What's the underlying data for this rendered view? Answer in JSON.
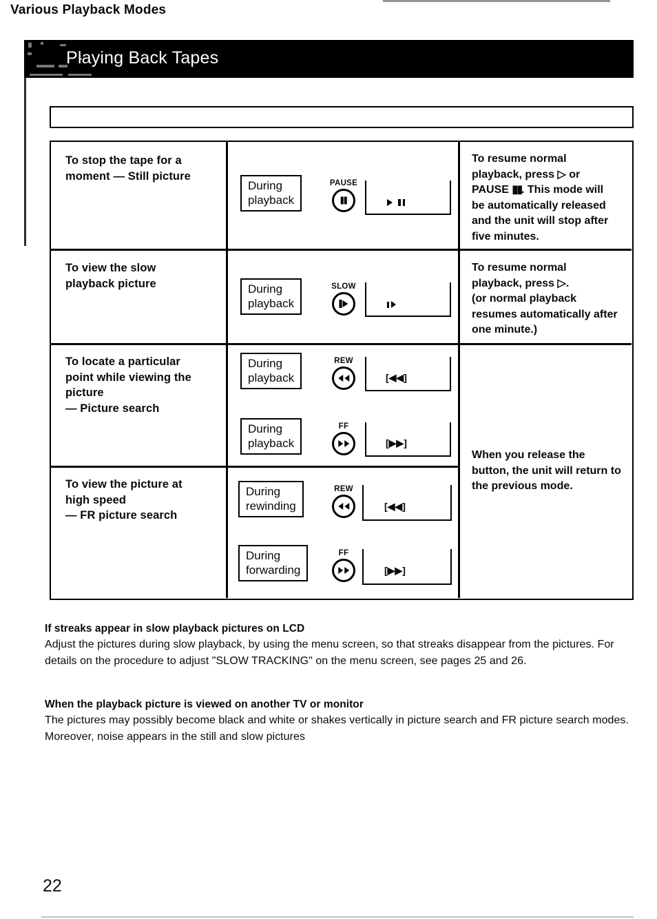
{
  "page": {
    "header_title": "Playing Back Tapes",
    "section_title": "Various Playback Modes",
    "page_number": "22"
  },
  "table": {
    "rows": [
      {
        "description": "To stop the tape for a\nmoment — Still picture",
        "operations": [
          {
            "state": "During\nplayback",
            "button_label": "PAUSE",
            "button_icon": "pause-icon",
            "lcd_indicator": "play-pause-indicator"
          }
        ],
        "note": "To resume normal playback, press ▷ or PAUSE ▮▮. This mode will be automatically released and the unit will stop after five minutes."
      },
      {
        "description": "To view the slow\nplayback picture",
        "operations": [
          {
            "state": "During\nplayback",
            "button_label": "SLOW",
            "button_icon": "slow-icon",
            "lcd_indicator": "slow-indicator"
          }
        ],
        "note": "To resume normal playback, press ▷.\n(or normal playback resumes automatically after one minute.)"
      },
      {
        "description": "To locate a particular\npoint while viewing the\npicture\n— Picture search",
        "operations": [
          {
            "state": "During\nplayback",
            "button_label": "REW",
            "button_icon": "rewind-icon",
            "lcd_indicator": "[◀◀]"
          },
          {
            "state": "During\nplayback",
            "button_label": "FF",
            "button_icon": "fast-forward-icon",
            "lcd_indicator": "[▶▶]"
          }
        ],
        "note": "When you release the button, the unit will return to the previous mode."
      },
      {
        "description": "To view the picture at\nhigh speed\n— FR picture search",
        "operations": [
          {
            "state": "During\nrewinding",
            "button_label": "REW",
            "button_icon": "rewind-icon",
            "lcd_indicator": "[◀◀]"
          },
          {
            "state": "During\nforwarding",
            "button_label": "FF",
            "button_icon": "fast-forward-icon",
            "lcd_indicator": "[▶▶]"
          }
        ],
        "note": ""
      }
    ]
  },
  "notes": [
    {
      "heading": "If streaks appear in slow playback pictures on LCD",
      "text": "Adjust the pictures during slow playback, by using the menu screen, so that streaks disappear from the pictures. For details on the procedure to adjust \"SLOW TRACKING\" on the menu screen, see pages 25 and 26."
    },
    {
      "heading": "When the playback picture is viewed on another TV or monitor",
      "text": "The pictures may possibly become black and white or shakes vertically in picture search and FR picture search modes. Moreover, noise appears in the still and slow pictures"
    }
  ],
  "colors": {
    "banner_background": "#000000",
    "banner_text": "#ffffff",
    "ink": "#0a0a0a",
    "paper": "#ffffff"
  }
}
